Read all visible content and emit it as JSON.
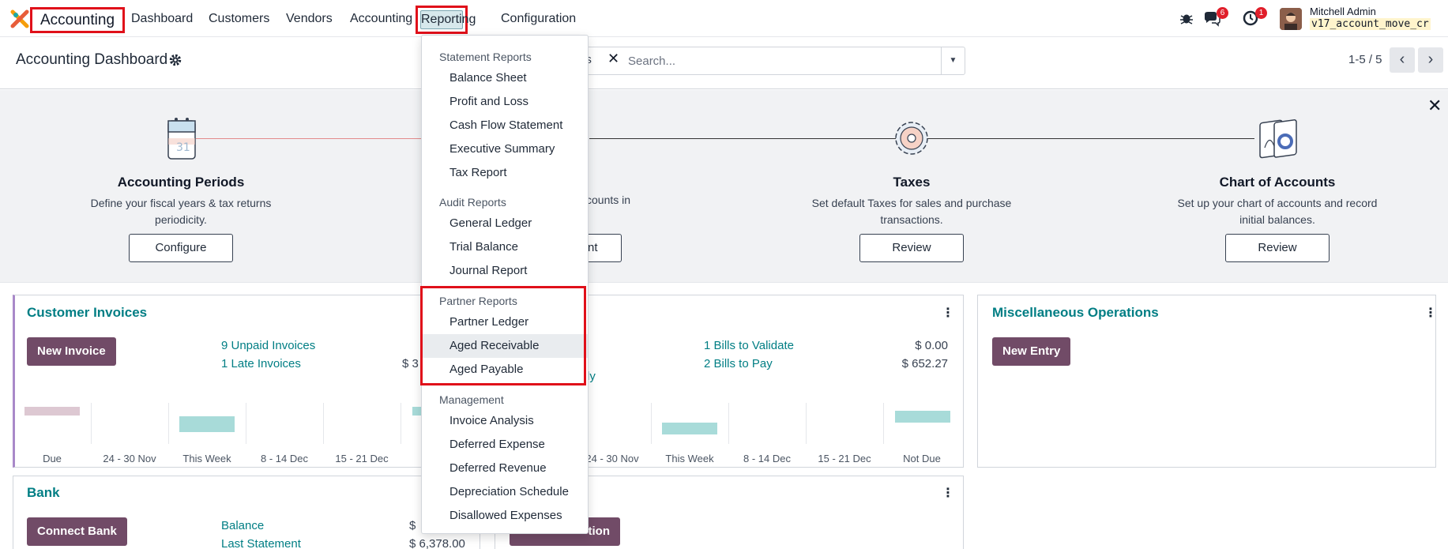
{
  "app": {
    "name": "Accounting"
  },
  "topnav": {
    "items": [
      "Dashboard",
      "Customers",
      "Vendors",
      "Accounting"
    ],
    "reporting": "Reporting",
    "configuration": "Configuration"
  },
  "systray": {
    "messages_count": "6",
    "activities_count": "1",
    "user_name": "Mitchell Admin",
    "db_name": "v17_account_move_cr"
  },
  "control": {
    "title": "Accounting Dashboard",
    "facet_partial": "es",
    "search_placeholder": "Search...",
    "pager": "1-5 / 5"
  },
  "onboarding": {
    "steps": [
      {
        "title": "Accounting Periods",
        "desc_line1": "Define your fiscal years & tax returns",
        "desc_line2": "periodicity.",
        "button": "Configure"
      },
      {
        "desc_partial": "counts in",
        "button_partial": "nt"
      },
      {
        "title": "Taxes",
        "desc_line1": "Set default Taxes for sales and purchase",
        "desc_line2": "transactions.",
        "button": "Review"
      },
      {
        "title": "Chart of Accounts",
        "desc_line1": "Set up your chart of accounts and record",
        "desc_line2": "initial balances.",
        "button": "Review"
      }
    ]
  },
  "cards": {
    "customer_invoices": {
      "title": "Customer Invoices",
      "button": "New Invoice",
      "links": [
        "9 Unpaid Invoices",
        "1 Late Invoices"
      ],
      "amount_partial": "$ 3",
      "graph_labels": [
        "Due",
        "24 - 30 Nov",
        "This Week",
        "8 - 14 Dec",
        "15 - 21 Dec"
      ]
    },
    "vendor_bills": {
      "links": [
        "1 Bills to Validate",
        "2 Bills to Pay"
      ],
      "link_partial": "ly",
      "amounts": [
        "$ 0.00",
        "$ 652.27"
      ],
      "graph_labels": [
        "24 - 30 Nov",
        "This Week",
        "8 - 14 Dec",
        "15 - 21 Dec",
        "Not Due"
      ]
    },
    "misc": {
      "title": "Miscellaneous Operations",
      "button": "New Entry"
    },
    "bank": {
      "title": "Bank",
      "button": "Connect Bank",
      "links": [
        "Balance",
        "Last Statement"
      ],
      "amount_partial": "$",
      "amount_last": "$ 6,378.00",
      "button2_partial": "tion"
    }
  },
  "reporting_menu": {
    "sections": [
      {
        "header": "Statement Reports",
        "items": [
          "Balance Sheet",
          "Profit and Loss",
          "Cash Flow Statement",
          "Executive Summary",
          "Tax Report"
        ]
      },
      {
        "header": "Audit Reports",
        "items": [
          "General Ledger",
          "Trial Balance",
          "Journal Report"
        ]
      },
      {
        "header": "Partner Reports",
        "items": [
          "Partner Ledger",
          "Aged Receivable",
          "Aged Payable"
        ]
      },
      {
        "header": "Management",
        "items": [
          "Invoice Analysis",
          "Deferred Expense",
          "Deferred Revenue",
          "Depreciation Schedule",
          "Disallowed Expenses"
        ]
      }
    ],
    "hovered": "Aged Receivable"
  },
  "colors": {
    "accent": "#017e84",
    "primary_button": "#714b67",
    "highlight_box": "#e0101a"
  }
}
